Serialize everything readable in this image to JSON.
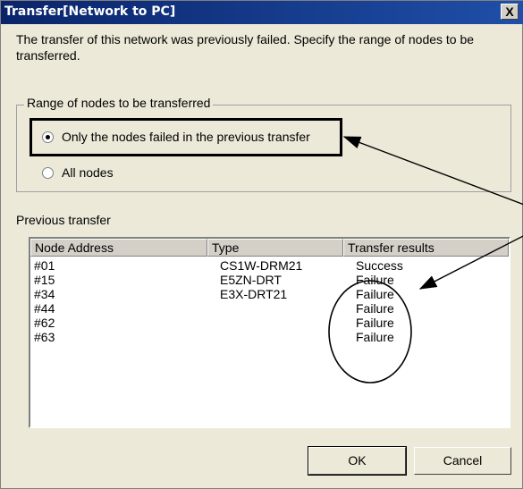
{
  "window": {
    "title": "Transfer[Network to PC]",
    "close_label": "X"
  },
  "description": "The transfer of this network was previously failed. Specify the range of nodes to be transferred.",
  "range_group": {
    "label": "Range of nodes to be transferred",
    "options": [
      {
        "label": "Only the nodes failed in the previous transfer",
        "selected": true
      },
      {
        "label": "All nodes",
        "selected": false
      }
    ]
  },
  "previous_transfer": {
    "label": "Previous transfer",
    "columns": [
      "Node Address",
      "Type",
      "Transfer results"
    ],
    "rows": [
      {
        "address": "#01",
        "type": "CS1W-DRM21",
        "result": "Success"
      },
      {
        "address": "#15",
        "type": "E5ZN-DRT",
        "result": "Failure"
      },
      {
        "address": "#34",
        "type": "E3X-DRT21",
        "result": "Failure"
      },
      {
        "address": "#44",
        "type": "",
        "result": "Failure"
      },
      {
        "address": "#62",
        "type": "",
        "result": "Failure"
      },
      {
        "address": "#63",
        "type": "",
        "result": "Failure"
      }
    ]
  },
  "buttons": {
    "ok": "OK",
    "cancel": "Cancel"
  }
}
